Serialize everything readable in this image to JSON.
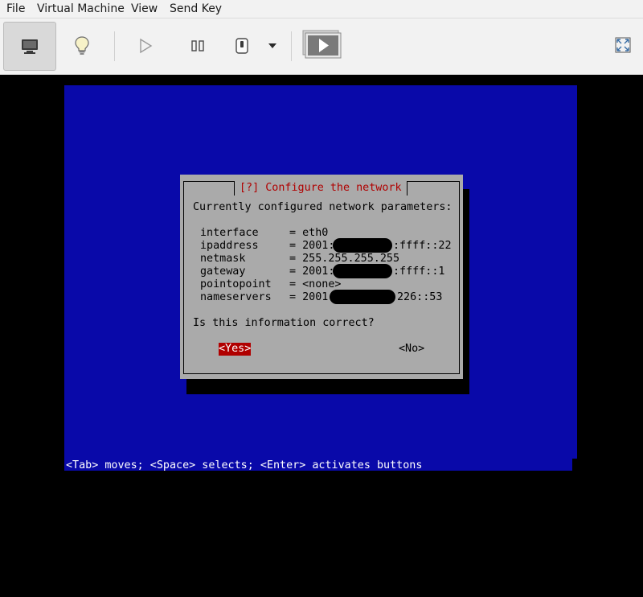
{
  "menubar": {
    "items": [
      "File",
      "Virtual Machine",
      "View",
      "Send Key"
    ]
  },
  "toolbar": {
    "buttons": [
      {
        "name": "console-view-button",
        "icon": "monitor-icon",
        "active": true
      },
      {
        "name": "details-view-button",
        "icon": "lightbulb-icon"
      },
      {
        "name": "run-button",
        "icon": "play-icon"
      },
      {
        "name": "pause-button",
        "icon": "pause-icon"
      },
      {
        "name": "shutdown-button",
        "icon": "power-icon"
      },
      {
        "name": "shutdown-menu-button",
        "icon": "caret-down-icon"
      },
      {
        "name": "snapshots-button",
        "icon": "snapshot-icon"
      },
      {
        "name": "fullscreen-button",
        "icon": "fullscreen-icon"
      }
    ]
  },
  "installer": {
    "dialog_title": "[?] Configure the network",
    "intro": "Currently configured network parameters:",
    "params": [
      {
        "key": "interface",
        "value": "= eth0"
      },
      {
        "key": "ipaddress",
        "value_prefix": "= 2001:",
        "value_suffix": ":ffff::22"
      },
      {
        "key": "netmask",
        "value": "= 255.255.255.255"
      },
      {
        "key": "gateway",
        "value_prefix": "= 2001:",
        "value_suffix": ":ffff::1"
      },
      {
        "key": "pointopoint",
        "value": "= <none>"
      },
      {
        "key": "nameservers",
        "value_prefix": "= 2001:",
        "value_suffix": "226::53"
      }
    ],
    "question": "Is this information correct?",
    "yes_label": "<Yes>",
    "no_label": "<No>",
    "status_bar": "<Tab> moves; <Space> selects; <Enter> activates buttons"
  },
  "colors": {
    "installer_background": "#0909a9",
    "dialog_background": "#aaaaaa",
    "title_color": "#b00000",
    "selected_button": "#b00000"
  }
}
